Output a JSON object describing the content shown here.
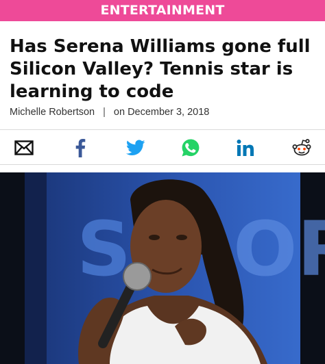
{
  "banner": {
    "label": "ENTERTAINMENT"
  },
  "article": {
    "headline": "Has Serena Williams gone full Silicon Valley? Tennis star is learning to code",
    "author": "Michelle Robertson",
    "separator": "|",
    "date": "on December 3, 2018"
  },
  "share": {
    "icons": [
      "email-icon",
      "facebook-icon",
      "twitter-icon",
      "whatsapp-icon",
      "linkedin-icon",
      "reddit-icon"
    ]
  },
  "photo": {
    "background_letters_left": "S",
    "background_letters_right": "OR"
  },
  "colors": {
    "banner": "#ee4a98",
    "facebook": "#3b5998",
    "twitter": "#1da1f2",
    "whatsapp": "#25d366",
    "linkedin": "#0077b5"
  }
}
